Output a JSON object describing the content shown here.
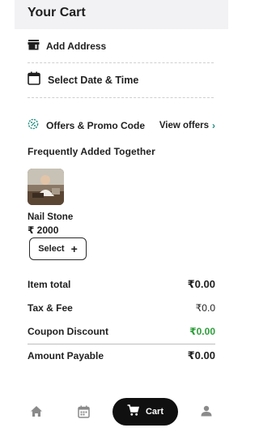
{
  "header": {
    "title": "Your Cart"
  },
  "rows": {
    "address_label": "Add Address",
    "date_label": "Select Date & Time"
  },
  "offers": {
    "label": "Offers & Promo Code",
    "link_label": "View offers"
  },
  "together": {
    "title": "Frequently Added Together",
    "product": {
      "name": "Nail Stone",
      "price": "₹ 2000",
      "button_label": "Select"
    }
  },
  "summary": {
    "item_total": {
      "label": "Item total",
      "value": "₹0.00"
    },
    "tax_fee": {
      "label": "Tax & Fee",
      "value": "₹0.0"
    },
    "coupon": {
      "label": "Coupon Discount",
      "value": "₹0.00"
    },
    "payable": {
      "label": "Amount Payable",
      "value": "₹0.00"
    }
  },
  "nav": {
    "cart_label": "Cart",
    "icons": [
      "home-icon",
      "calendar-icon",
      "cart-icon",
      "profile-icon"
    ]
  },
  "colors": {
    "accent": "#1f8f84",
    "discount_green": "#2e9e3a",
    "nav_pill": "#101010",
    "header_bg": "#f2f2f5"
  }
}
